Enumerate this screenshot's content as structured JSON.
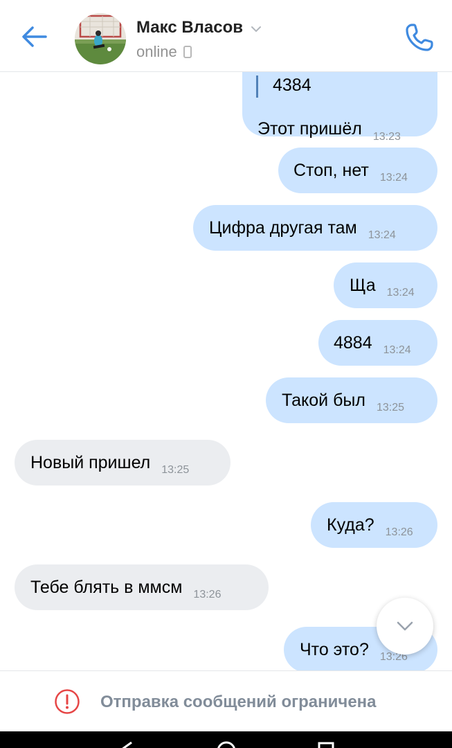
{
  "header": {
    "contact_name": "Макс Власов",
    "status": "online"
  },
  "messages": [
    {
      "direction": "outgoing",
      "quote": "4384",
      "text": "Этот пришёл",
      "time": "13:23"
    },
    {
      "direction": "outgoing",
      "text": "Стоп, нет",
      "time": "13:24"
    },
    {
      "direction": "outgoing",
      "text": "Цифра другая там",
      "time": "13:24"
    },
    {
      "direction": "outgoing",
      "text": "Ща",
      "time": "13:24"
    },
    {
      "direction": "outgoing",
      "text": "4884",
      "time": "13:24"
    },
    {
      "direction": "outgoing",
      "text": "Такой был",
      "time": "13:25"
    },
    {
      "direction": "incoming",
      "text": "Новый пришел",
      "time": "13:25"
    },
    {
      "direction": "outgoing",
      "text": "Куда?",
      "time": "13:26"
    },
    {
      "direction": "incoming",
      "text": "Тебе блять в ммсм",
      "time": "13:26"
    },
    {
      "direction": "outgoing",
      "text": "Что это?",
      "time": "13:26"
    }
  ],
  "footer": {
    "restriction_text": "Отправка сообщений ограничена"
  },
  "colors": {
    "accent": "#3f8ae0",
    "outgoing_bubble": "#cce4ff",
    "incoming_bubble": "#ebedf0",
    "warning": "#e64646"
  },
  "icons": [
    "back-arrow-icon",
    "chevron-down-icon",
    "phone-device-icon",
    "call-icon",
    "scroll-down-chevron-icon",
    "warning-icon",
    "nav-back-icon",
    "nav-home-icon",
    "nav-recents-icon"
  ]
}
